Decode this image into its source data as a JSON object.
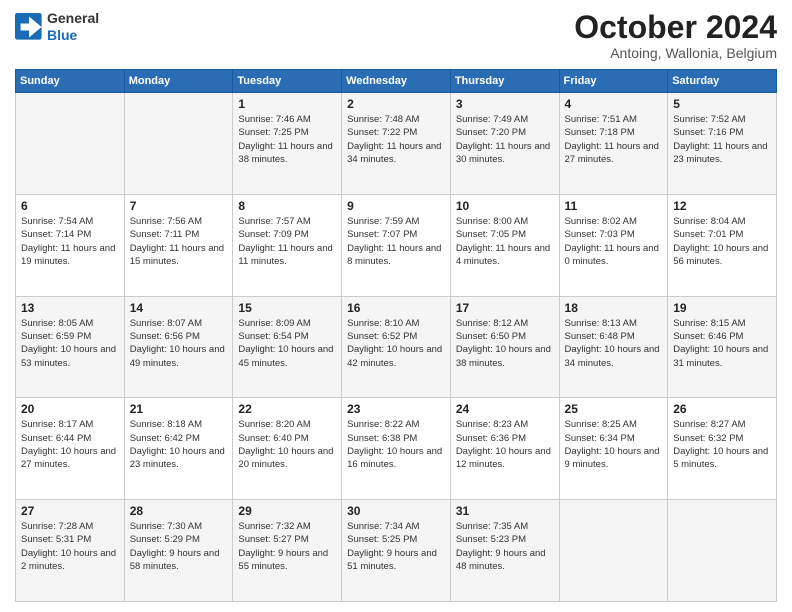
{
  "header": {
    "logo": {
      "line1": "General",
      "line2": "Blue"
    },
    "title": "October 2024",
    "subtitle": "Antoing, Wallonia, Belgium"
  },
  "weekdays": [
    "Sunday",
    "Monday",
    "Tuesday",
    "Wednesday",
    "Thursday",
    "Friday",
    "Saturday"
  ],
  "weeks": [
    [
      {
        "day": "",
        "info": ""
      },
      {
        "day": "",
        "info": ""
      },
      {
        "day": "1",
        "info": "Sunrise: 7:46 AM\nSunset: 7:25 PM\nDaylight: 11 hours and 38 minutes."
      },
      {
        "day": "2",
        "info": "Sunrise: 7:48 AM\nSunset: 7:22 PM\nDaylight: 11 hours and 34 minutes."
      },
      {
        "day": "3",
        "info": "Sunrise: 7:49 AM\nSunset: 7:20 PM\nDaylight: 11 hours and 30 minutes."
      },
      {
        "day": "4",
        "info": "Sunrise: 7:51 AM\nSunset: 7:18 PM\nDaylight: 11 hours and 27 minutes."
      },
      {
        "day": "5",
        "info": "Sunrise: 7:52 AM\nSunset: 7:16 PM\nDaylight: 11 hours and 23 minutes."
      }
    ],
    [
      {
        "day": "6",
        "info": "Sunrise: 7:54 AM\nSunset: 7:14 PM\nDaylight: 11 hours and 19 minutes."
      },
      {
        "day": "7",
        "info": "Sunrise: 7:56 AM\nSunset: 7:11 PM\nDaylight: 11 hours and 15 minutes."
      },
      {
        "day": "8",
        "info": "Sunrise: 7:57 AM\nSunset: 7:09 PM\nDaylight: 11 hours and 11 minutes."
      },
      {
        "day": "9",
        "info": "Sunrise: 7:59 AM\nSunset: 7:07 PM\nDaylight: 11 hours and 8 minutes."
      },
      {
        "day": "10",
        "info": "Sunrise: 8:00 AM\nSunset: 7:05 PM\nDaylight: 11 hours and 4 minutes."
      },
      {
        "day": "11",
        "info": "Sunrise: 8:02 AM\nSunset: 7:03 PM\nDaylight: 11 hours and 0 minutes."
      },
      {
        "day": "12",
        "info": "Sunrise: 8:04 AM\nSunset: 7:01 PM\nDaylight: 10 hours and 56 minutes."
      }
    ],
    [
      {
        "day": "13",
        "info": "Sunrise: 8:05 AM\nSunset: 6:59 PM\nDaylight: 10 hours and 53 minutes."
      },
      {
        "day": "14",
        "info": "Sunrise: 8:07 AM\nSunset: 6:56 PM\nDaylight: 10 hours and 49 minutes."
      },
      {
        "day": "15",
        "info": "Sunrise: 8:09 AM\nSunset: 6:54 PM\nDaylight: 10 hours and 45 minutes."
      },
      {
        "day": "16",
        "info": "Sunrise: 8:10 AM\nSunset: 6:52 PM\nDaylight: 10 hours and 42 minutes."
      },
      {
        "day": "17",
        "info": "Sunrise: 8:12 AM\nSunset: 6:50 PM\nDaylight: 10 hours and 38 minutes."
      },
      {
        "day": "18",
        "info": "Sunrise: 8:13 AM\nSunset: 6:48 PM\nDaylight: 10 hours and 34 minutes."
      },
      {
        "day": "19",
        "info": "Sunrise: 8:15 AM\nSunset: 6:46 PM\nDaylight: 10 hours and 31 minutes."
      }
    ],
    [
      {
        "day": "20",
        "info": "Sunrise: 8:17 AM\nSunset: 6:44 PM\nDaylight: 10 hours and 27 minutes."
      },
      {
        "day": "21",
        "info": "Sunrise: 8:18 AM\nSunset: 6:42 PM\nDaylight: 10 hours and 23 minutes."
      },
      {
        "day": "22",
        "info": "Sunrise: 8:20 AM\nSunset: 6:40 PM\nDaylight: 10 hours and 20 minutes."
      },
      {
        "day": "23",
        "info": "Sunrise: 8:22 AM\nSunset: 6:38 PM\nDaylight: 10 hours and 16 minutes."
      },
      {
        "day": "24",
        "info": "Sunrise: 8:23 AM\nSunset: 6:36 PM\nDaylight: 10 hours and 12 minutes."
      },
      {
        "day": "25",
        "info": "Sunrise: 8:25 AM\nSunset: 6:34 PM\nDaylight: 10 hours and 9 minutes."
      },
      {
        "day": "26",
        "info": "Sunrise: 8:27 AM\nSunset: 6:32 PM\nDaylight: 10 hours and 5 minutes."
      }
    ],
    [
      {
        "day": "27",
        "info": "Sunrise: 7:28 AM\nSunset: 5:31 PM\nDaylight: 10 hours and 2 minutes."
      },
      {
        "day": "28",
        "info": "Sunrise: 7:30 AM\nSunset: 5:29 PM\nDaylight: 9 hours and 58 minutes."
      },
      {
        "day": "29",
        "info": "Sunrise: 7:32 AM\nSunset: 5:27 PM\nDaylight: 9 hours and 55 minutes."
      },
      {
        "day": "30",
        "info": "Sunrise: 7:34 AM\nSunset: 5:25 PM\nDaylight: 9 hours and 51 minutes."
      },
      {
        "day": "31",
        "info": "Sunrise: 7:35 AM\nSunset: 5:23 PM\nDaylight: 9 hours and 48 minutes."
      },
      {
        "day": "",
        "info": ""
      },
      {
        "day": "",
        "info": ""
      }
    ]
  ]
}
